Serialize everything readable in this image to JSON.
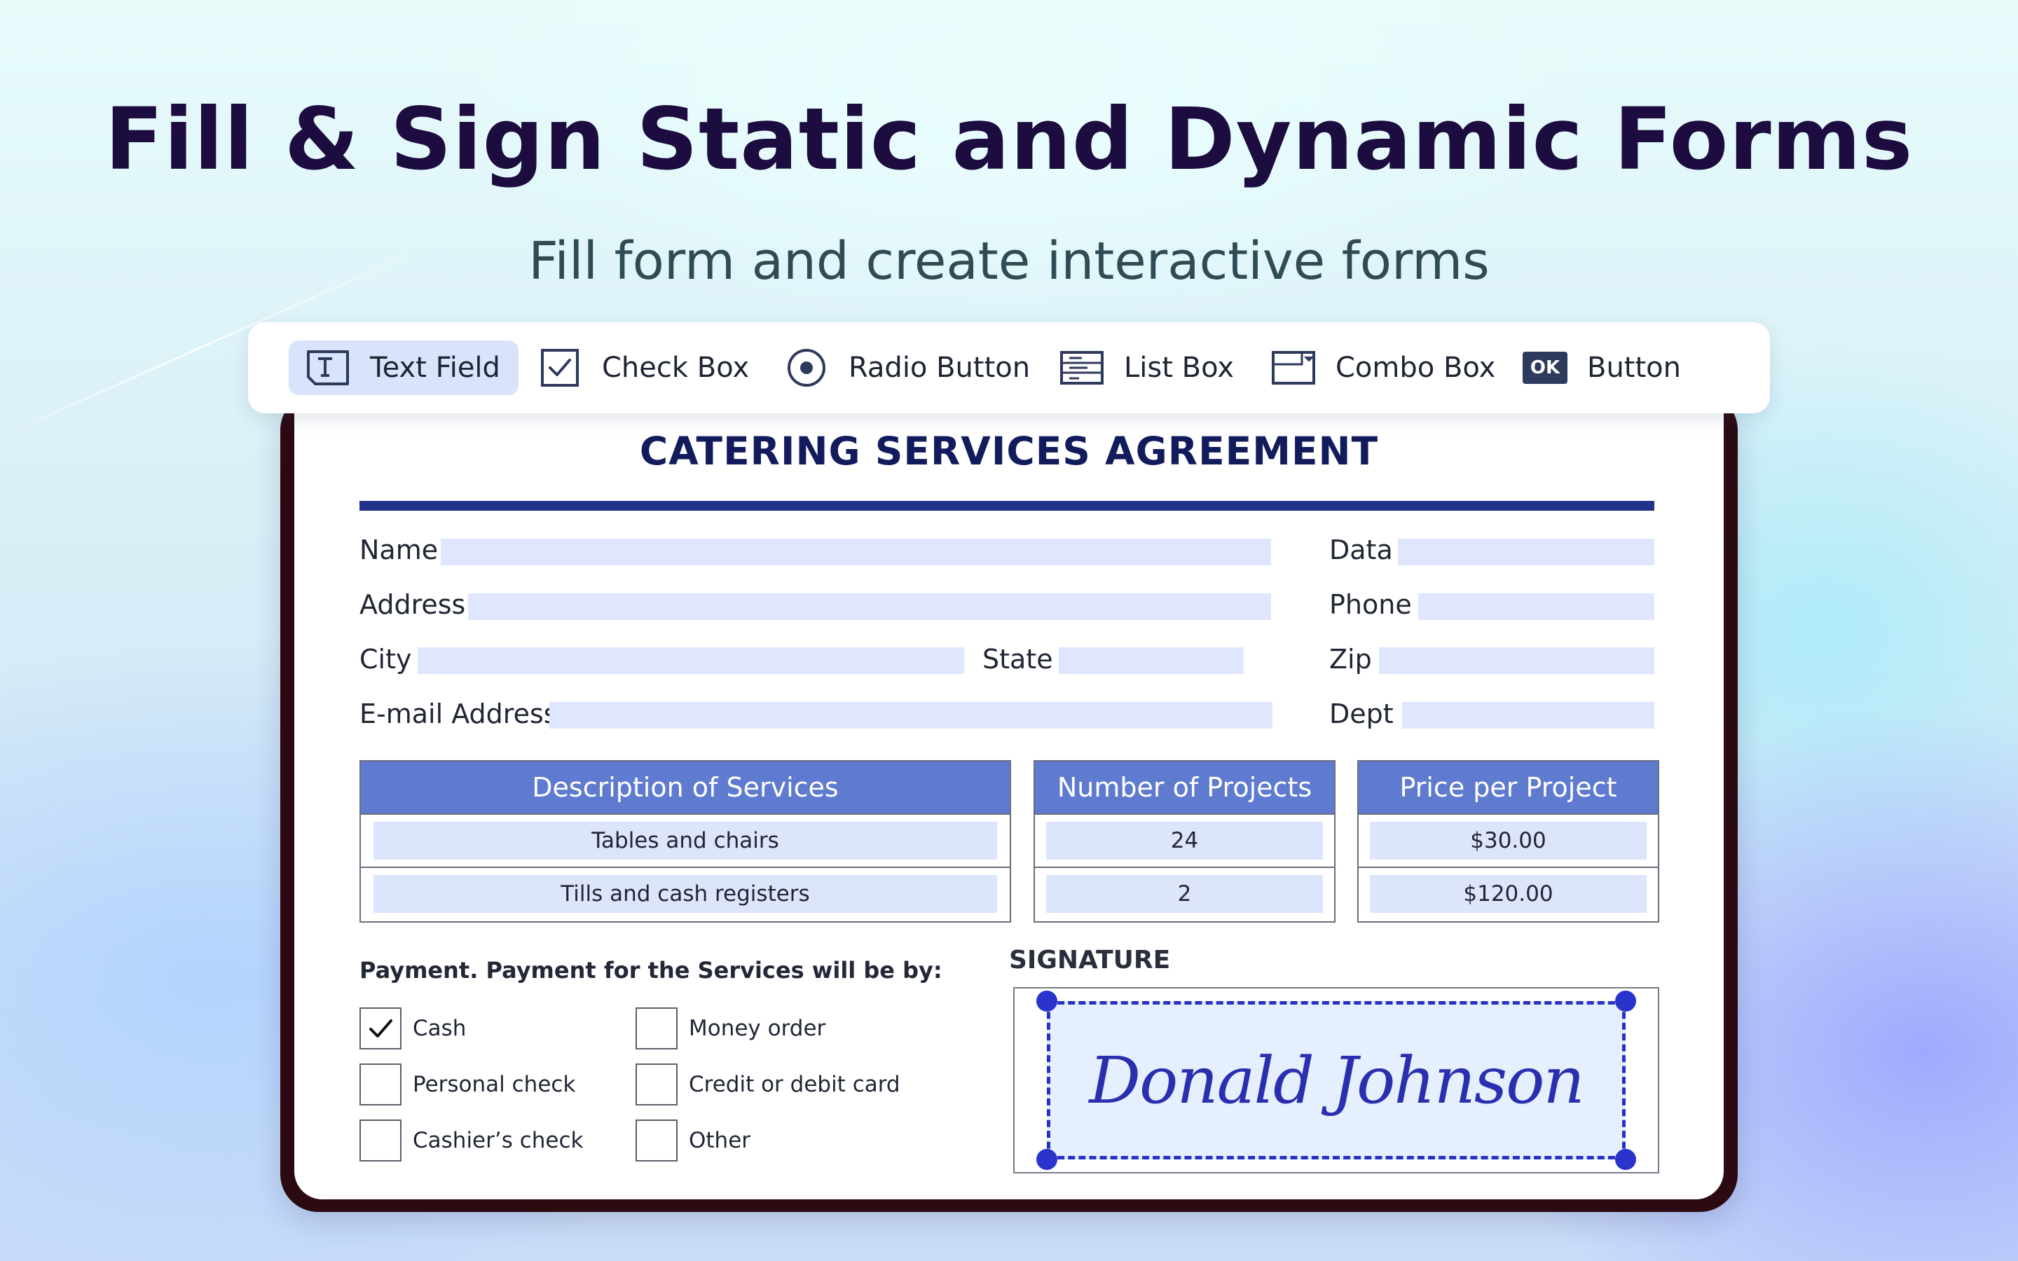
{
  "hero": {
    "title": "Fill & Sign Static and Dynamic Forms",
    "subtitle": "Fill form and create interactive forms"
  },
  "toolbar": {
    "items": [
      {
        "label": "Text Field",
        "icon": "text-field-icon",
        "active": true
      },
      {
        "label": "Check Box",
        "icon": "checkbox-icon"
      },
      {
        "label": "Radio Button",
        "icon": "radio-button-icon"
      },
      {
        "label": "List Box",
        "icon": "list-box-icon"
      },
      {
        "label": "Combo Box",
        "icon": "combo-box-icon"
      },
      {
        "label": "Button",
        "icon": "ok-button-icon",
        "icon_text": "OK"
      }
    ]
  },
  "form": {
    "title": "CATERING SERVICES AGREEMENT",
    "fields": {
      "name": "Name",
      "data": "Data",
      "address": "Address",
      "phone": "Phone",
      "city": "City",
      "state": "State",
      "zip": "Zip",
      "email": "E-mail Address",
      "dept": "Dept"
    },
    "services_table": {
      "desc_header": "Description of Services",
      "count_header": "Number of Projects",
      "price_header": "Price per Project",
      "rows": [
        {
          "description": "Tables and chairs",
          "count": "24",
          "price": "$30.00"
        },
        {
          "description": "Tills and cash registers",
          "count": "2",
          "price": "$120.00"
        }
      ]
    },
    "payment": {
      "title": "Payment. Payment for the Services will be by:",
      "options": [
        {
          "label": "Cash",
          "checked": true
        },
        {
          "label": "Money order",
          "checked": false
        },
        {
          "label": "Personal check",
          "checked": false
        },
        {
          "label": "Credit or debit card",
          "checked": false
        },
        {
          "label": "Cashier’s check",
          "checked": false
        },
        {
          "label": "Other",
          "checked": false
        }
      ]
    },
    "signature": {
      "title": "SIGNATURE",
      "value": "Donald Johnson"
    }
  },
  "colors": {
    "headline": "#1c0c40",
    "accent_blue": "#22348a",
    "table_header": "#5f7bd0",
    "field_fill": "#dfe6fd",
    "signature_ink": "#2a2fb0"
  }
}
